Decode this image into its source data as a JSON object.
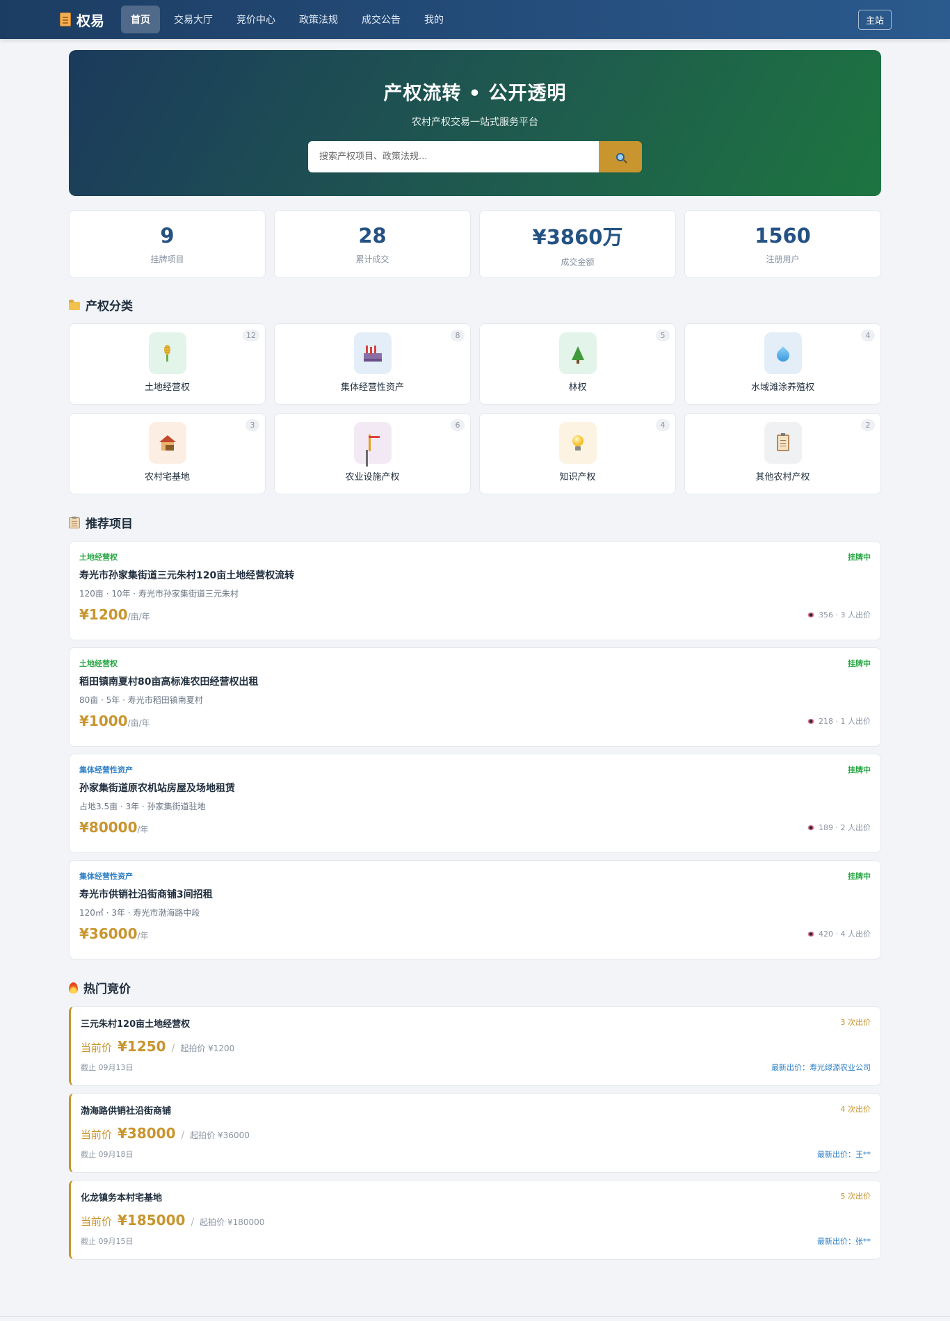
{
  "nav": {
    "brand": "权易",
    "links": [
      "首页",
      "交易大厅",
      "竞价中心",
      "政策法规",
      "成交公告",
      "我的"
    ],
    "main_site": "主站"
  },
  "hero": {
    "title": "产权流转 • 公开透明",
    "subtitle": "农村产权交易一站式服务平台",
    "search_placeholder": "搜索产权项目、政策法规..."
  },
  "stats": [
    {
      "value": "9",
      "label": "挂牌项目"
    },
    {
      "value": "28",
      "label": "累计成交"
    },
    {
      "value": "¥3860万",
      "label": "成交金额"
    },
    {
      "value": "1560",
      "label": "注册用户"
    }
  ],
  "categories_section": {
    "title": "产权分类",
    "items": [
      {
        "label": "土地经营权",
        "count": "12",
        "icon": "wheat-icon",
        "bg": "#e3f4ea"
      },
      {
        "label": "集体经营性资产",
        "count": "8",
        "icon": "factory-icon",
        "bg": "#e3eef8"
      },
      {
        "label": "林权",
        "count": "5",
        "icon": "tree-icon",
        "bg": "#e3f4ea"
      },
      {
        "label": "水域滩涂养殖权",
        "count": "4",
        "icon": "water-drop-icon",
        "bg": "#e3eef8"
      },
      {
        "label": "农村宅基地",
        "count": "3",
        "icon": "house-icon",
        "bg": "#fdeee3"
      },
      {
        "label": "农业设施产权",
        "count": "6",
        "icon": "crane-icon",
        "bg": "#f3e9f5"
      },
      {
        "label": "知识产权",
        "count": "4",
        "icon": "lightbulb-icon",
        "bg": "#fdf3e3"
      },
      {
        "label": "其他农村产权",
        "count": "2",
        "icon": "clipboard-icon",
        "bg": "#f0f1f3"
      }
    ]
  },
  "projects_section": {
    "title": "推荐项目",
    "items": [
      {
        "category": "土地经营权",
        "category_color": "#28a745",
        "status": "挂牌中",
        "title": "寿光市孙家集街道三元朱村120亩土地经营权流转",
        "meta": "120亩 · 10年 · 寿光市孙家集街道三元朱村",
        "price": "¥1200",
        "unit": "/亩/年",
        "stats": "356 · 3 人出价"
      },
      {
        "category": "土地经营权",
        "category_color": "#28a745",
        "status": "挂牌中",
        "title": "稻田镇南夏村80亩高标准农田经营权出租",
        "meta": "80亩 · 5年 · 寿光市稻田镇南夏村",
        "price": "¥1000",
        "unit": "/亩/年",
        "stats": "218 · 1 人出价"
      },
      {
        "category": "集体经营性资产",
        "category_color": "#2d7fc4",
        "status": "挂牌中",
        "title": "孙家集街道原农机站房屋及场地租赁",
        "meta": "占地3.5亩 · 3年 · 孙家集街道驻地",
        "price": "¥80000",
        "unit": "/年",
        "stats": "189 · 2 人出价"
      },
      {
        "category": "集体经营性资产",
        "category_color": "#2d7fc4",
        "status": "挂牌中",
        "title": "寿光市供销社沿街商铺3间招租",
        "meta": "120㎡ · 3年 · 寿光市渤海路中段",
        "price": "¥36000",
        "unit": "/年",
        "stats": "420 · 4 人出价"
      }
    ]
  },
  "auctions_section": {
    "title": "热门竞价",
    "items": [
      {
        "title": "三元朱村120亩土地经营权",
        "bids": "3 次出价",
        "current_label": "当前价",
        "current_price": "¥1250",
        "sep": "/",
        "start": "起拍价 ¥1200",
        "deadline": "截止 09月13日",
        "latest": "最新出价：寿光绿源农业公司"
      },
      {
        "title": "渤海路供销社沿街商铺",
        "bids": "4 次出价",
        "current_label": "当前价",
        "current_price": "¥38000",
        "sep": "/",
        "start": "起拍价 ¥36000",
        "deadline": "截止 09月18日",
        "latest": "最新出价：王**"
      },
      {
        "title": "化龙镇务本村宅基地",
        "bids": "5 次出价",
        "current_label": "当前价",
        "current_price": "¥185000",
        "sep": "/",
        "start": "起拍价 ¥180000",
        "deadline": "截止 09月15日",
        "latest": "最新出价：张**"
      }
    ]
  }
}
